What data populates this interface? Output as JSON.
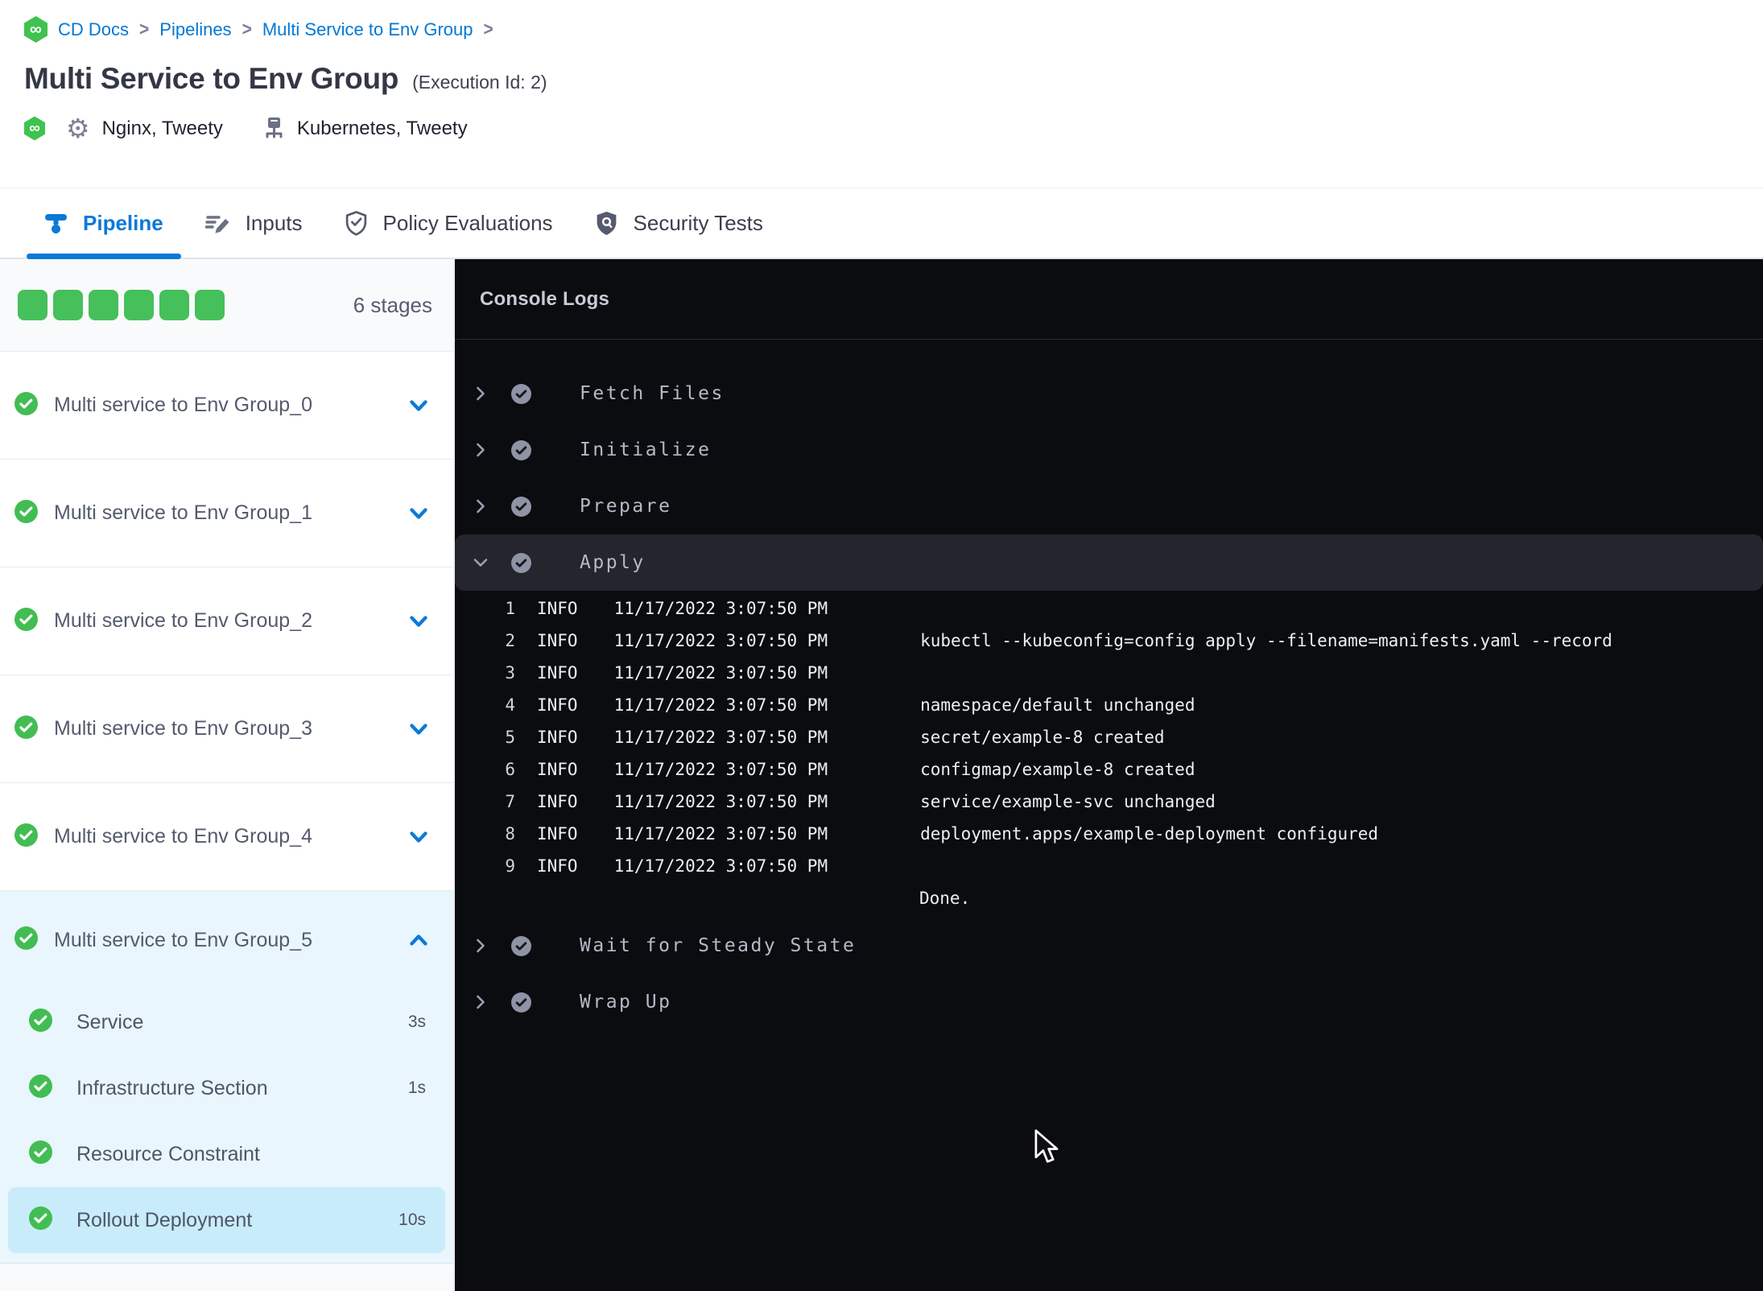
{
  "colors": {
    "accent_blue": "#0b79d7",
    "link_blue": "#0278d5",
    "success_green": "#45c05a",
    "check_green": "#42bd53",
    "console_bg": "#0b0c0f",
    "console_row_highlight": "#24252d",
    "expanded_group_bg": "#e9f6fd",
    "selected_step_bg": "#c9ecfa"
  },
  "breadcrumb": {
    "separator": ">",
    "items": [
      "CD Docs",
      "Pipelines",
      "Multi Service to Env Group"
    ]
  },
  "header": {
    "title": "Multi Service to Env Group",
    "execution_id": "(Execution Id: 2)",
    "services": "Nginx, Tweety",
    "infrastructure": "Kubernetes, Tweety"
  },
  "tabs": [
    {
      "label": "Pipeline",
      "active": true
    },
    {
      "label": "Inputs",
      "active": false
    },
    {
      "label": "Policy Evaluations",
      "active": false
    },
    {
      "label": "Security Tests",
      "active": false
    }
  ],
  "sidebar": {
    "stage_count": 6,
    "stage_count_label": "6 stages",
    "stages": [
      {
        "label": "Multi service to Env Group_0",
        "status": "success",
        "expanded": false
      },
      {
        "label": "Multi service to Env Group_1",
        "status": "success",
        "expanded": false
      },
      {
        "label": "Multi service to Env Group_2",
        "status": "success",
        "expanded": false
      },
      {
        "label": "Multi service to Env Group_3",
        "status": "success",
        "expanded": false
      },
      {
        "label": "Multi service to Env Group_4",
        "status": "success",
        "expanded": false
      },
      {
        "label": "Multi service to Env Group_5",
        "status": "success",
        "expanded": true,
        "steps": [
          {
            "label": "Service",
            "duration": "3s",
            "selected": false
          },
          {
            "label": "Infrastructure Section",
            "duration": "1s",
            "selected": false
          },
          {
            "label": "Resource Constraint",
            "duration": "",
            "selected": false
          },
          {
            "label": "Rollout Deployment",
            "duration": "10s",
            "selected": true
          }
        ]
      }
    ]
  },
  "console": {
    "title": "Console Logs",
    "steps": [
      {
        "name": "Fetch Files",
        "status": "success",
        "expanded": false
      },
      {
        "name": "Initialize",
        "status": "success",
        "expanded": false
      },
      {
        "name": "Prepare",
        "status": "success",
        "expanded": false
      },
      {
        "name": "Apply",
        "status": "success",
        "expanded": true,
        "logs": [
          {
            "n": "1",
            "level": "INFO",
            "time": "11/17/2022 3:07:50 PM",
            "message": ""
          },
          {
            "n": "2",
            "level": "INFO",
            "time": "11/17/2022 3:07:50 PM",
            "message": "kubectl --kubeconfig=config apply --filename=manifests.yaml --record"
          },
          {
            "n": "3",
            "level": "INFO",
            "time": "11/17/2022 3:07:50 PM",
            "message": ""
          },
          {
            "n": "4",
            "level": "INFO",
            "time": "11/17/2022 3:07:50 PM",
            "message": "namespace/default unchanged"
          },
          {
            "n": "5",
            "level": "INFO",
            "time": "11/17/2022 3:07:50 PM",
            "message": "secret/example-8 created"
          },
          {
            "n": "6",
            "level": "INFO",
            "time": "11/17/2022 3:07:50 PM",
            "message": "configmap/example-8 created"
          },
          {
            "n": "7",
            "level": "INFO",
            "time": "11/17/2022 3:07:50 PM",
            "message": "service/example-svc unchanged"
          },
          {
            "n": "8",
            "level": "INFO",
            "time": "11/17/2022 3:07:50 PM",
            "message": "deployment.apps/example-deployment configured"
          },
          {
            "n": "9",
            "level": "INFO",
            "time": "11/17/2022 3:07:50 PM",
            "message": ""
          }
        ],
        "footer": "Done."
      },
      {
        "name": "Wait for Steady State",
        "status": "success",
        "expanded": false
      },
      {
        "name": "Wrap Up",
        "status": "success",
        "expanded": false
      }
    ]
  }
}
